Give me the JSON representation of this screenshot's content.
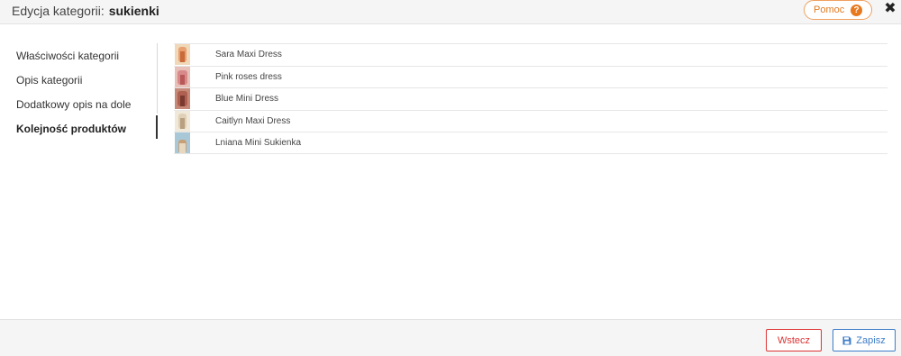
{
  "header": {
    "title_label": "Edycja kategorii:",
    "category_name": "sukienki",
    "help_label": "Pomoc",
    "help_icon": "question-icon",
    "close_icon": "close-icon"
  },
  "sidebar": {
    "items": [
      {
        "label": "Właściwości kategorii",
        "active": false
      },
      {
        "label": "Opis kategorii",
        "active": false
      },
      {
        "label": "Dodatkowy opis na dole",
        "active": false
      },
      {
        "label": "Kolejność produktów",
        "active": true
      }
    ]
  },
  "products": [
    {
      "name": "Sara Maxi Dress",
      "thumb_colors": [
        "#e8a070",
        "#c86a3a",
        "#f0d8b8"
      ]
    },
    {
      "name": "Pink roses dress",
      "thumb_colors": [
        "#d88a8a",
        "#b85858",
        "#e8c0b8"
      ]
    },
    {
      "name": "Blue Mini Dress",
      "thumb_colors": [
        "#b06050",
        "#7a3a30",
        "#c88a78"
      ]
    },
    {
      "name": "Caitlyn Maxi Dress",
      "thumb_colors": [
        "#e0d0b8",
        "#b8a080",
        "#f0e8d8"
      ]
    },
    {
      "name": "Lniana Mini Sukienka",
      "thumb_colors": [
        "#a8c8d8",
        "#c8a078",
        "#e8d8c0"
      ]
    }
  ],
  "footer": {
    "back_label": "Wstecz",
    "save_label": "Zapisz",
    "save_icon": "floppy-disk-icon"
  },
  "colors": {
    "accent_orange": "#e8791e",
    "danger_red": "#dd3333",
    "primary_blue": "#3d7cc9"
  }
}
